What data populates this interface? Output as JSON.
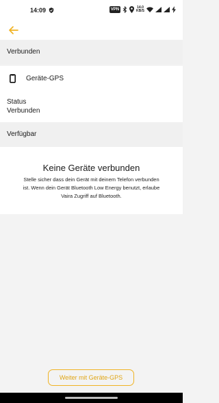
{
  "status_bar": {
    "time": "14:09",
    "vpn_label": "VPN",
    "net_speed_value": "14.0",
    "net_speed_unit": "KB/S"
  },
  "app_bar": {
    "back_icon": "arrow-left-icon",
    "accent_color": "#f0b323"
  },
  "sections": {
    "connected_header": "Verbunden",
    "available_header": "Verfügbar"
  },
  "device": {
    "icon": "smartphone-icon",
    "name": "Geräte-GPS",
    "status_label": "Status",
    "status_value": "Verbunden"
  },
  "empty_state": {
    "title": "Keine Geräte verbunden",
    "body": "Stelle sicher dass dein Gerät mit deinem Telefon verbunden ist. Wenn dein Gerät Bluetooth Low Energy benutzt, erlaube Vaira Zugriff auf Bluetooth."
  },
  "footer": {
    "continue_label": "Weiter mit Geräte-GPS"
  }
}
